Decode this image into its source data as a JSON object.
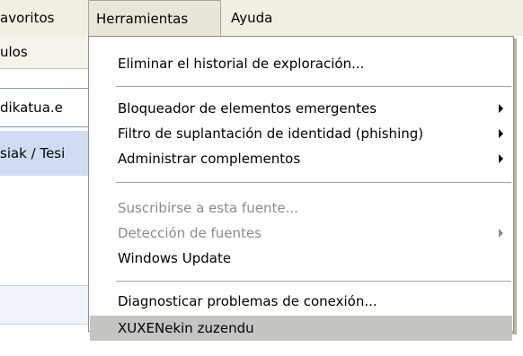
{
  "menubar": {
    "favoritos": "avoritos",
    "herramientas": "Herramientas",
    "ayuda": "Ayuda"
  },
  "background": {
    "row1": "ulos",
    "row2": "dikatua.e",
    "row3": "siak / Tesi"
  },
  "menu": {
    "items": [
      {
        "label": "Eliminar el historial de exploración...",
        "enabled": true,
        "submenu": false
      },
      {
        "label": "Bloqueador de elementos emergentes",
        "enabled": true,
        "submenu": true
      },
      {
        "label": "Filtro de suplantación de identidad (phishing)",
        "enabled": true,
        "submenu": true
      },
      {
        "label": "Administrar complementos",
        "enabled": true,
        "submenu": true
      },
      {
        "label": "Suscribirse a esta fuente...",
        "enabled": false,
        "submenu": false
      },
      {
        "label": "Detección de fuentes",
        "enabled": false,
        "submenu": true
      },
      {
        "label": "Windows Update",
        "enabled": true,
        "submenu": false
      },
      {
        "label": "Diagnosticar problemas de conexión...",
        "enabled": true,
        "submenu": false
      },
      {
        "label": "XUXENekin zuzendu",
        "enabled": true,
        "submenu": false,
        "highlighted": true
      }
    ]
  },
  "colors": {
    "menubar_bg": "#f1efe2",
    "highlight": "#c5c4c0",
    "disabled_text": "#8b8b8b"
  }
}
